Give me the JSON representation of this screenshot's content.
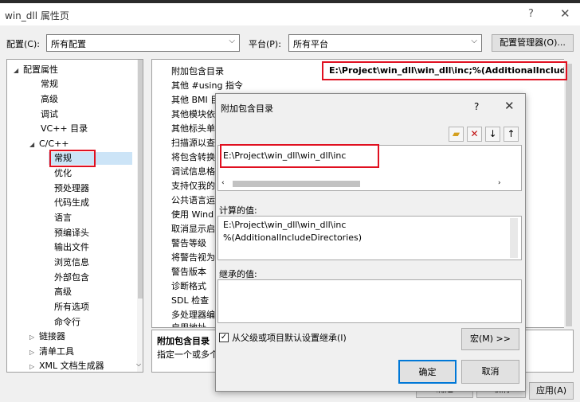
{
  "window": {
    "title": "win_dll 属性页",
    "help": "?",
    "close": "✕"
  },
  "toolbar": {
    "config_label": "配置(C):",
    "config_value": "所有配置",
    "platform_label": "平台(P):",
    "platform_value": "所有平台",
    "config_manager": "配置管理器(O)..."
  },
  "tree": {
    "root": "配置属性",
    "items": [
      "常规",
      "高级",
      "调试",
      "VC++ 目录"
    ],
    "cpp": "C/C++",
    "cpp_children": [
      "常规",
      "优化",
      "预处理器",
      "代码生成",
      "语言",
      "预编译头",
      "输出文件",
      "浏览信息",
      "外部包含",
      "高级",
      "所有选项",
      "命令行"
    ],
    "collapsed": [
      "链接器",
      "清单工具",
      "XML 文档生成器"
    ]
  },
  "grid": {
    "rows": [
      "附加包含目录",
      "其他 #using 指令",
      "其他 BMI 目",
      "其他模块依",
      "其他标头单",
      "扫描源以查",
      "将包含转换",
      "调试信息格",
      "支持仅我的",
      "公共语言运",
      "使用 Wind",
      "取消显示启",
      "警告等级",
      "将警告视为",
      "警告版本",
      "诊断格式",
      "SDL 检查",
      "多处理器编",
      "启用地址"
    ],
    "selected_value": "E:\\Project\\win_dll\\win_dll\\inc;%(AdditionalInclude",
    "desc_title": "附加包含目录",
    "desc_text": "指定一个或多个"
  },
  "dialog": {
    "title": "附加包含目录",
    "help": "?",
    "close": "✕",
    "entry": "E:\\Project\\win_dll\\win_dll\\inc",
    "computed_label": "计算的值:",
    "computed_lines": [
      "E:\\Project\\win_dll\\win_dll\\inc",
      "%(AdditionalIncludeDirectories)"
    ],
    "inherited_label": "继承的值:",
    "inherit_checkbox": "从父级或项目默认设置继承(I)",
    "macro_button": "宏(M) >>",
    "ok": "确定",
    "cancel": "取消"
  },
  "footer": {
    "ok": "确定",
    "cancel": "取消",
    "apply": "应用(A)"
  }
}
